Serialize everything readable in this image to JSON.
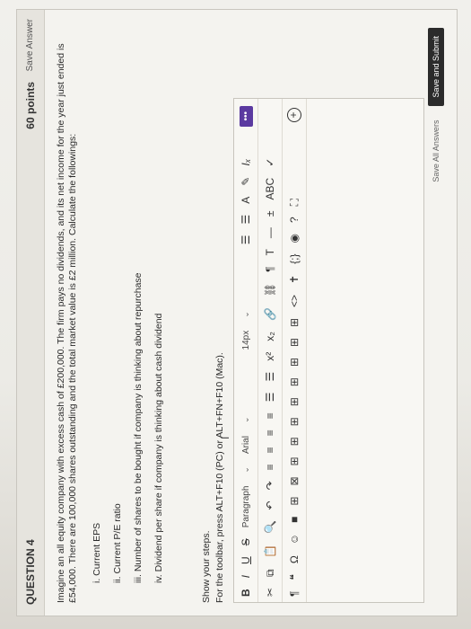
{
  "question": {
    "title": "QUESTION 4",
    "points": "60 points",
    "save_answer": "Save Answer",
    "text": "Imagine an all equity company with excess cash of £200,000. The firm pays no dividends, and its net income for the year just ended is £54,000. There are 100,000 shares outstanding and the total market value is £2 million. Calculate the followings:",
    "items": [
      "i.  Current EPS",
      "ii.  Current P/E ratio",
      "iii.  Number of shares to be bought if company is thinking about repurchase",
      "iv.  Dividend per share if company is thinking about cash dividend"
    ]
  },
  "instructions": {
    "show_steps": "Show your steps.",
    "toolbar_hint": "For the toolbar, press ALT+F10 (PC) or ALT+FN+F10 (Mac)."
  },
  "editor": {
    "format_buttons": [
      "B",
      "I",
      "U",
      "S"
    ],
    "paragraph": "Paragraph",
    "font": "Arial",
    "size": "14px",
    "more": "•••",
    "row2_icons": [
      "✂",
      "⧉",
      "📋",
      "🔍",
      "↶",
      "↷",
      "≡",
      "≡",
      "≡",
      "≡",
      "☰",
      "☰",
      "x²",
      "x₂",
      "🔗",
      "⛓",
      "¶",
      "T",
      "—",
      "±",
      "ABC",
      "✓"
    ],
    "row3_icons": [
      "¶",
      "❝",
      "Ω",
      "☺",
      "■",
      "⊞",
      "⊠",
      "⊞",
      "⊞",
      "⊞",
      "⊞",
      "⊞",
      "⊞",
      "⊞",
      "⊞",
      "<>",
      "✝",
      "{;}",
      "◉",
      "?",
      "⛶"
    ]
  },
  "footer": {
    "save_all": "Save All Answers",
    "submit": "Save and Submit"
  }
}
